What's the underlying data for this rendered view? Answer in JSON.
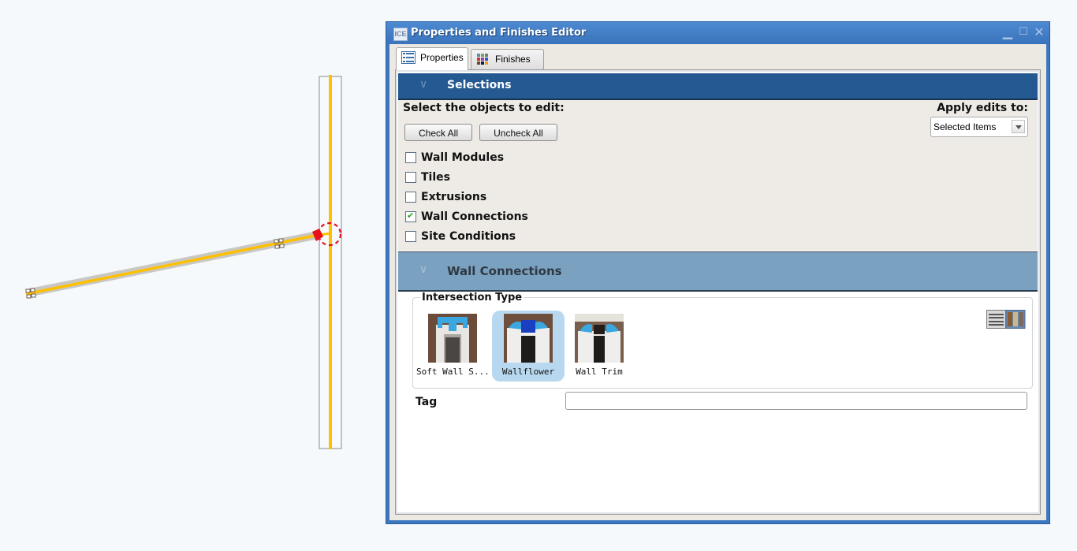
{
  "window": {
    "app_icon_text": "ICE",
    "title": "Properties and Finishes Editor",
    "controls": [
      "minimize",
      "maximize",
      "close"
    ]
  },
  "tabs": [
    {
      "label": "Properties",
      "icon": "list-icon",
      "active": true
    },
    {
      "label": "Finishes",
      "icon": "color-grid-icon",
      "active": false
    }
  ],
  "selections": {
    "section_title": "Selections",
    "prompt": "Select the objects to edit:",
    "check_all_label": "Check All",
    "uncheck_all_label": "Uncheck All",
    "apply_label": "Apply edits to:",
    "apply_value": "Selected Items",
    "items": [
      {
        "label": "Wall Modules",
        "checked": false
      },
      {
        "label": "Tiles",
        "checked": false
      },
      {
        "label": "Extrusions",
        "checked": false
      },
      {
        "label": "Wall Connections",
        "checked": true
      },
      {
        "label": "Site Conditions",
        "checked": false
      }
    ]
  },
  "wall_connections": {
    "section_title": "Wall Connections",
    "intersection_type_label": "Intersection Type",
    "options": [
      {
        "label": "Soft Wall S...",
        "selected": false
      },
      {
        "label": "Wallflower",
        "selected": true
      },
      {
        "label": "Wall Trim",
        "selected": false
      }
    ],
    "tag_label": "Tag",
    "tag_value": ""
  },
  "colors": {
    "accent_yellow": "#ffc000",
    "selection_red": "#e8101a",
    "section_header": "#245a91",
    "window_frame": "#3c78c0"
  }
}
